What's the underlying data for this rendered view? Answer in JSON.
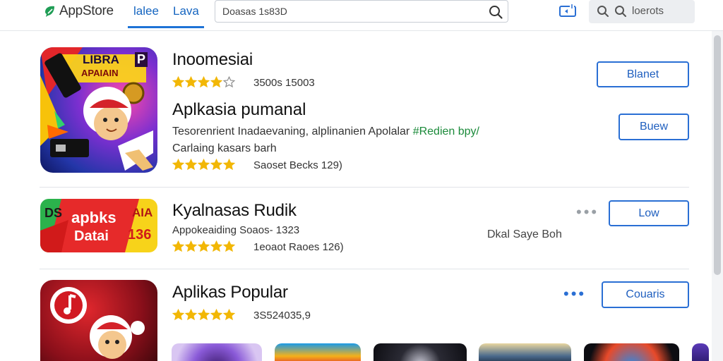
{
  "header": {
    "logo_text": "AppStore",
    "tabs": [
      {
        "label": "lalee"
      },
      {
        "label": "Lava"
      }
    ],
    "search": {
      "value": "Doasas 1s83D"
    },
    "right_pill": {
      "text": "loerots"
    }
  },
  "apps": [
    {
      "title": "Inoomesiai",
      "rating_text": "3500s 15003",
      "stars": 4,
      "subheading": "Aplkasia pumanal",
      "description_prefix": "Tesorenrient Inadaevaning, alplinanien Apolalar ",
      "description_highlight": "#Redien bpy/",
      "description_line2": "Carlaing kasars barh",
      "rating2_text": "Saoset Becks  129)",
      "stars2": 5,
      "icon_text_top": "LIBRA",
      "icon_text_p": "P",
      "icon_text_sub": "APAIAIN",
      "button_primary": "Blanet",
      "button_secondary": "Buew",
      "accent_color": "#1b8a3a"
    },
    {
      "title": "Kyalnasas Rudik",
      "meta_text": "Appokeaiding  Soaos- 1323",
      "rating_text": "1eoaot Raoes  126)",
      "stars": 5,
      "side_note": "Dkal Saye Boh",
      "icon_text_left": "DS",
      "icon_text_main": "apbks",
      "icon_text_main2": "Datai",
      "icon_text_right": "AIA",
      "icon_text_num": "136",
      "button": "Low"
    },
    {
      "title": "Aplikas Popular",
      "rating_text": "3S524035,9",
      "stars": 5,
      "button": "Couaris"
    }
  ],
  "colors": {
    "accent": "#1e73d6",
    "star": "#f2b705",
    "button_border": "#2a6fd4"
  },
  "icons": [
    "logo-leaf-icon",
    "search-icon",
    "cast-icon",
    "search-icon",
    "search-icon",
    "star-icon",
    "more-dots-icon"
  ]
}
